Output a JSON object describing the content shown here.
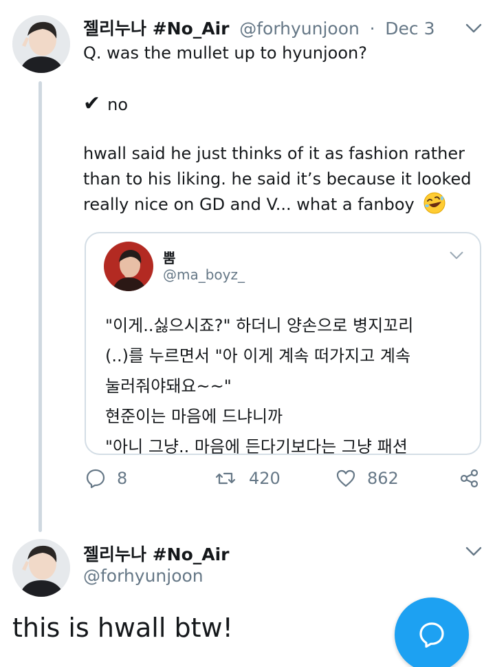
{
  "tweet1": {
    "display_name": "젤리누나 #No_Air",
    "handle": "@forhyunjoon",
    "separator": "·",
    "date": "Dec 3",
    "question": "Q. was the mullet up to hyunjoon?",
    "answer_mark": "✔",
    "answer": "no",
    "body_lines": [
      "hwall said he just thinks of it as fashion rather",
      "than to his liking. he said it’s because it looked",
      "really nice on GD and V... what a fanboy"
    ],
    "emoji": "rolling-on-the-floor-laughing-icon",
    "quoted": {
      "display_name": "뿜",
      "handle": "@ma_boyz_",
      "lines": [
        "\"이게..싫으시죠?\" 하더니 양손으로 병지꼬리",
        "(..)를 누르면서 \"아 이게 계속 떠가지고 계속",
        "눌러줘야돼요~~\"",
        "현준이는 마음에 드냐니까",
        "\"아니 그냥.. 마음에 든다기보다는 그냥 패션"
      ]
    },
    "actions": {
      "replies": "8",
      "retweets": "420",
      "likes": "862"
    }
  },
  "tweet2": {
    "display_name": "젤리누나 #No_Air",
    "handle": "@forhyunjoon",
    "text": "this is hwall btw!"
  },
  "colors": {
    "accent": "#1da1f2",
    "muted": "#657786",
    "thread_line": "#cfd8e0",
    "border": "#d3dde5"
  }
}
